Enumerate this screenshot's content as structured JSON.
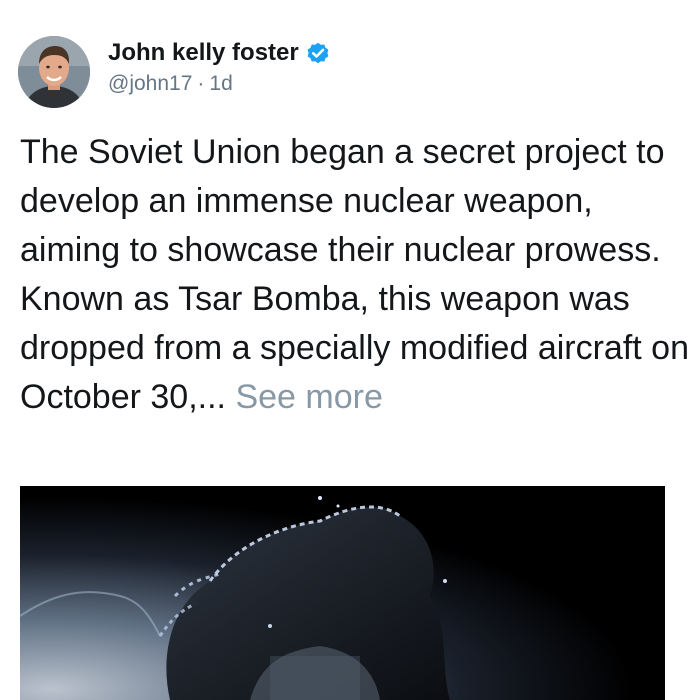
{
  "author": {
    "display_name": "John kelly foster",
    "handle": "@john17",
    "separator": "·",
    "time_ago": "1d",
    "verified": true
  },
  "post": {
    "text": "The Soviet Union began a secret project to develop an immense nuclear weapon, aiming to showcase their nuclear prowess. Known as Tsar Bomba, this weapon was dropped from a specially modified aircraft on October 30,... ",
    "see_more_label": "See more"
  },
  "icons": {
    "verified": "verified-badge-icon"
  },
  "colors": {
    "verified_badge": "#1da1f2",
    "see_more": "#8899a6",
    "meta_text": "#657786",
    "body_text": "#14171a",
    "media_background": "#000000"
  }
}
